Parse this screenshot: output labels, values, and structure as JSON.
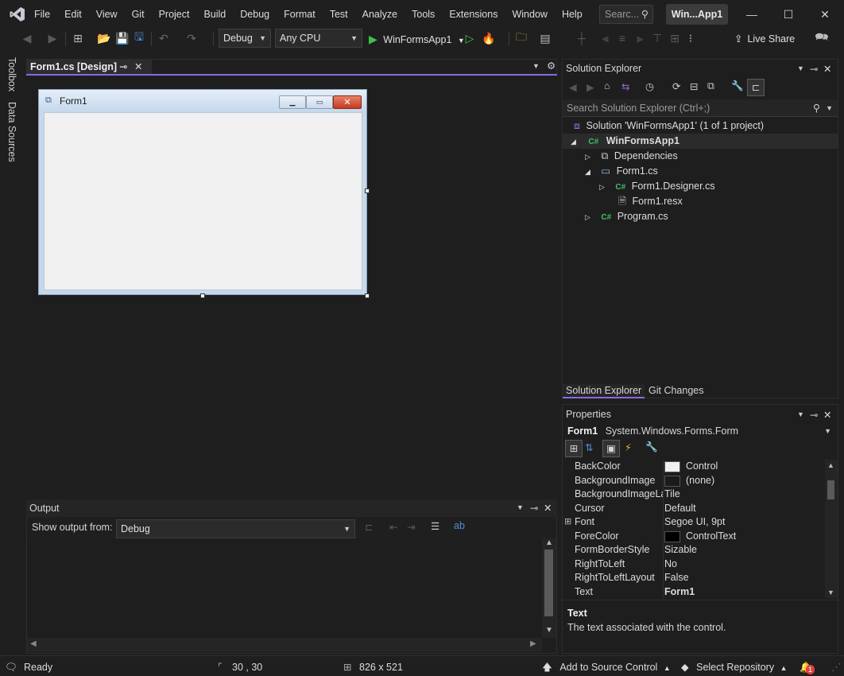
{
  "menu": [
    "File",
    "Edit",
    "View",
    "Git",
    "Project",
    "Build",
    "Debug",
    "Format",
    "Test",
    "Analyze",
    "Tools",
    "Extensions",
    "Window",
    "Help"
  ],
  "search_placeholder": "Searc...",
  "app_badge": "Win...App1",
  "toolbar": {
    "config": "Debug",
    "platform": "Any CPU",
    "run_label": "WinFormsApp1",
    "live_share": "Live Share"
  },
  "left_rail": {
    "toolbox": "Toolbox",
    "data_sources": "Data Sources"
  },
  "document": {
    "tab_title": "Form1.cs [Design]",
    "form_title": "Form1"
  },
  "output": {
    "title": "Output",
    "show_from_label": "Show output from:",
    "source": "Debug"
  },
  "solution_explorer": {
    "title": "Solution Explorer",
    "search_placeholder": "Search Solution Explorer (Ctrl+;)",
    "solution": "Solution 'WinFormsApp1' (1 of 1 project)",
    "project": "WinFormsApp1",
    "items": [
      "Dependencies",
      "Form1.cs",
      "Form1.Designer.cs",
      "Form1.resx",
      "Program.cs"
    ],
    "tabs": [
      "Solution Explorer",
      "Git Changes"
    ]
  },
  "properties": {
    "title": "Properties",
    "object_name": "Form1",
    "object_type": "System.Windows.Forms.Form",
    "rows": [
      {
        "name": "BackColor",
        "value": "Control",
        "swatch": "#f0f0f0"
      },
      {
        "name": "BackgroundImage",
        "value": "(none)",
        "swatch": "#1b1b1b"
      },
      {
        "name": "BackgroundImageLayout",
        "value": "Tile"
      },
      {
        "name": "Cursor",
        "value": "Default"
      },
      {
        "name": "Font",
        "value": "Segoe UI, 9pt"
      },
      {
        "name": "ForeColor",
        "value": "ControlText",
        "swatch": "#000000"
      },
      {
        "name": "FormBorderStyle",
        "value": "Sizable"
      },
      {
        "name": "RightToLeft",
        "value": "No"
      },
      {
        "name": "RightToLeftLayout",
        "value": "False"
      },
      {
        "name": "Text",
        "value": "Form1"
      }
    ],
    "desc_title": "Text",
    "desc_body": "The text associated with the control."
  },
  "status": {
    "ready": "Ready",
    "position": "30 , 30",
    "size": "826 x 521",
    "source_control": "Add to Source Control",
    "repository": "Select Repository",
    "notifications": "1"
  },
  "colors": {
    "accent": "#8a6ae0",
    "run_green": "#3fbf4b",
    "vs_purple": "#9b6bdf"
  }
}
